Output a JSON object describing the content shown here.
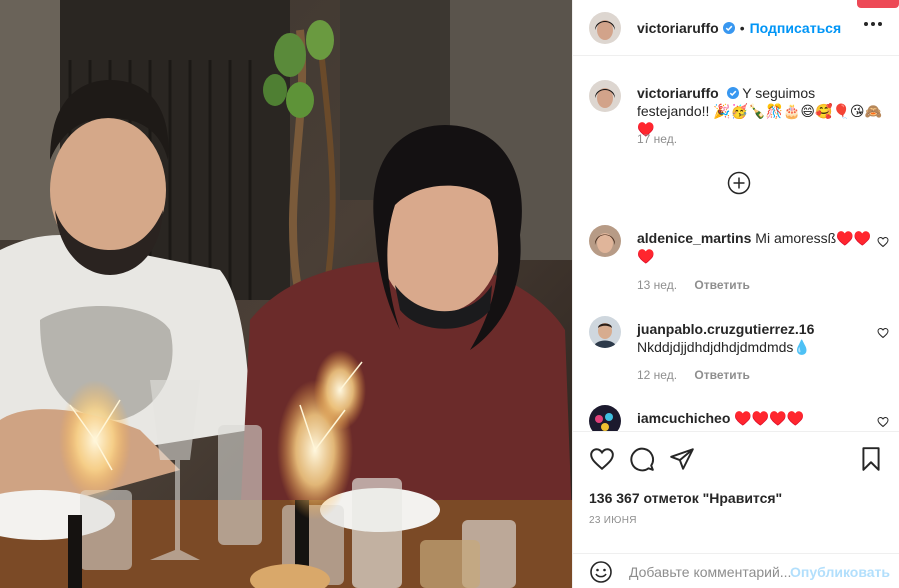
{
  "header": {
    "username": "victoriaruffo",
    "separator": "•",
    "follow_label": "Подписаться"
  },
  "caption": {
    "username": "victoriaruffo",
    "text": "Y seguimos festejando!! 🎉🥳🍾🎊🎂😄🥰🎈😘🙈♥️",
    "time": "17 нед."
  },
  "comments": [
    {
      "username": "aldenice_martins",
      "text": "Mi amoressß♥️♥️ ♥️",
      "time": "13 нед.",
      "reply": "Ответить"
    },
    {
      "username": "juanpablo.cruzgutierrez.16",
      "text": "Nkddjdjjdhdjdhdjdmdmds💧",
      "time": "12 нед.",
      "reply": "Ответить"
    },
    {
      "username": "iamcuchicheo",
      "text": "♥️♥️♥️♥️",
      "time": "",
      "reply": ""
    }
  ],
  "post": {
    "likes": "136 367 отметок \"Нравится\"",
    "date": "23 июня"
  },
  "composer": {
    "placeholder": "Добавьте комментарий...",
    "post_label": "Опубликовать"
  },
  "colors": {
    "accent": "#0095f6",
    "muted": "#8e8e8e",
    "post_disabled": "#b2dffc"
  }
}
